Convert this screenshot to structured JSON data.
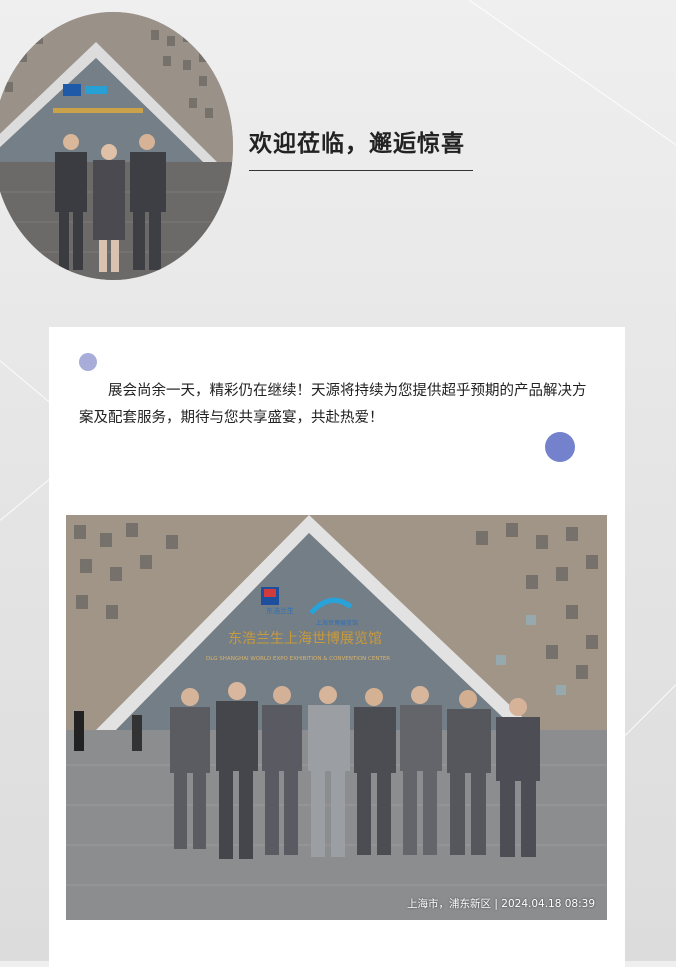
{
  "header": {
    "headline": "欢迎莅临，邂逅惊喜"
  },
  "card": {
    "intro": "展会尚余一天，精彩仍在继续！天源将持续为您提供超乎预期的产品解决方案及配套服务，期待与您共享盛宴，共赴热爱！"
  },
  "photo": {
    "sign_logo_left": "东浩兰生",
    "sign_logo_right": "上海世博展览馆",
    "sign_title": "东浩兰生上海世博展览馆",
    "sign_subtitle": "DLG SHANGHAI WORLD EXPO EXHIBITION & CONVENTION CENTER",
    "caption_location": "上海市，浦东新区",
    "caption_time": "2024.04.18 08:39"
  },
  "colors": {
    "dot_light": "#a7add8",
    "dot_dark": "#7482ce",
    "headline": "#222222"
  }
}
